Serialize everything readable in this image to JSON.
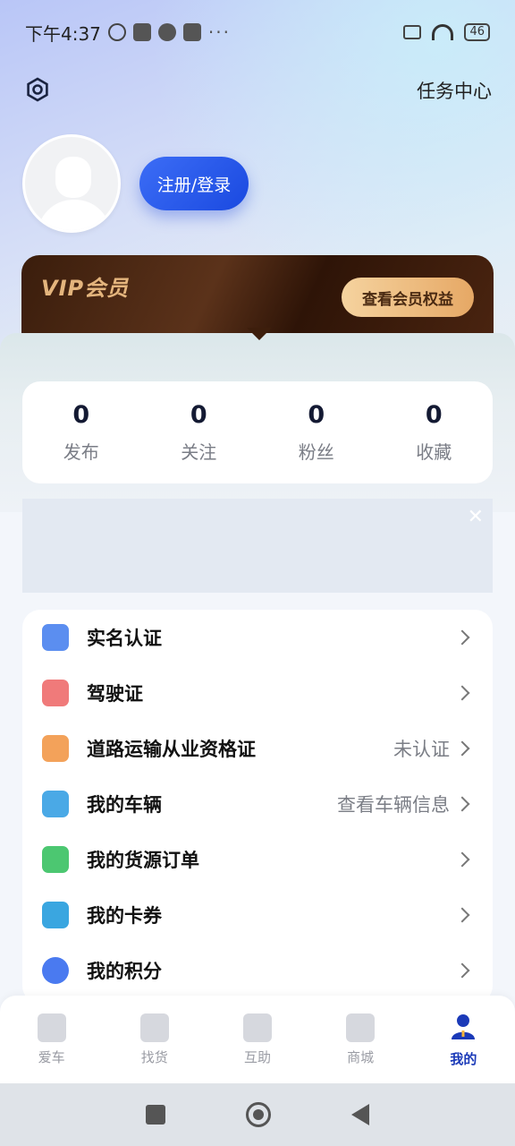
{
  "status_bar": {
    "time": "下午4:37",
    "battery": "46",
    "more": "···"
  },
  "header": {
    "settings_icon": "settings-icon",
    "task_center": "任务中心"
  },
  "profile": {
    "login_label": "注册/登录"
  },
  "vip": {
    "title": "VIP会员",
    "button": "查看会员权益"
  },
  "stats": [
    {
      "num": "0",
      "label": "发布"
    },
    {
      "num": "0",
      "label": "关注"
    },
    {
      "num": "0",
      "label": "粉丝"
    },
    {
      "num": "0",
      "label": "收藏"
    }
  ],
  "banner": {
    "close": "✕"
  },
  "menu": [
    {
      "label": "实名认证",
      "value": "",
      "icon": "id-verify-icon",
      "color": "#5b8ef0"
    },
    {
      "label": "驾驶证",
      "value": "",
      "icon": "driver-license-icon",
      "color": "#f07a7a"
    },
    {
      "label": "道路运输从业资格证",
      "value": "未认证",
      "icon": "transport-license-icon",
      "color": "#f3a25a"
    },
    {
      "label": "我的车辆",
      "value": "查看车辆信息",
      "icon": "truck-icon",
      "color": "#4aa9e6"
    },
    {
      "label": "我的货源订单",
      "value": "",
      "icon": "cargo-order-icon",
      "color": "#4cc771"
    },
    {
      "label": "我的卡券",
      "value": "",
      "icon": "coupon-icon",
      "color": "#3aa6e0"
    },
    {
      "label": "我的积分",
      "value": "",
      "icon": "points-icon",
      "color": "#4a7af0"
    }
  ],
  "tabs": [
    {
      "label": "爱车",
      "icon": "car-icon",
      "active": false
    },
    {
      "label": "找货",
      "icon": "box-icon",
      "active": false
    },
    {
      "label": "互助",
      "icon": "chat-icon",
      "active": false
    },
    {
      "label": "商城",
      "icon": "shop-bag-icon",
      "active": false
    },
    {
      "label": "我的",
      "icon": "user-icon",
      "active": true
    }
  ]
}
